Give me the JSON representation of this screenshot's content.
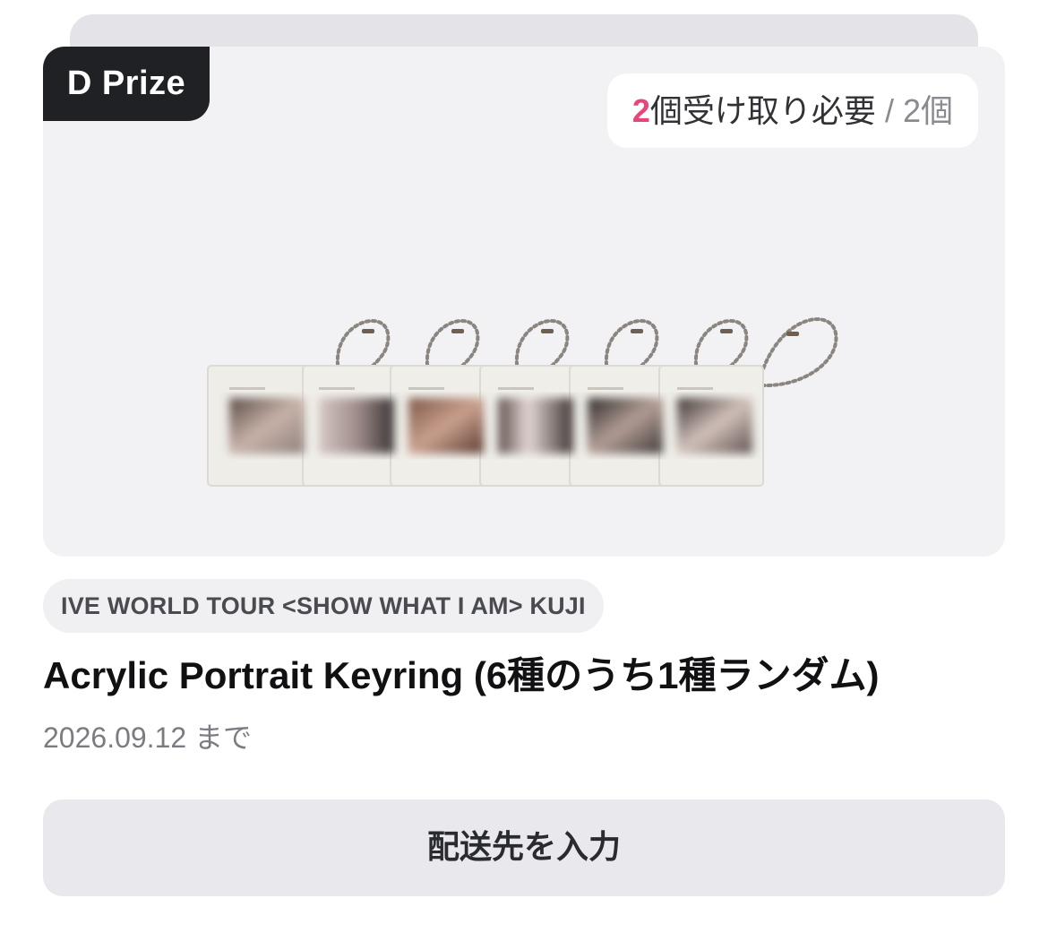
{
  "prize": {
    "badge_label": "D Prize",
    "count": {
      "required_number": "2",
      "required_suffix": "個受け取り必要",
      "separator": "/",
      "total": "2個"
    }
  },
  "product": {
    "image_icon": "acrylic-keyring-set-image",
    "tag": "IVE WORLD TOUR <SHOW WHAT I AM> KUJI",
    "title": "Acrylic Portrait Keyring (6種のうち1種ランダム)",
    "deadline": "2026.09.12 まで"
  },
  "actions": {
    "enter_address_label": "配送先を入力"
  },
  "colors": {
    "accent": "#e8457a",
    "badge_bg": "#202124",
    "card_bg": "#f2f2f4",
    "button_bg": "#e9e9ed"
  }
}
